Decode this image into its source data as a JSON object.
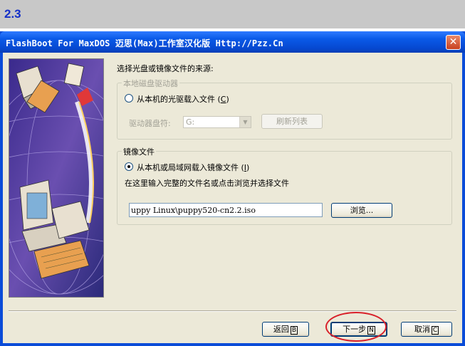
{
  "step_label": "2.3",
  "window": {
    "title": "FlashBoot For MaxDOS 迈思(Max)工作室汉化版 Http://Pzz.Cn",
    "close_glyph": "✕"
  },
  "prompt": "选择光盘或镜像文件的来源:",
  "local_drive": {
    "group_label": "本地磁盘驱动器",
    "radio_label": "从本机的光驱载入文件",
    "radio_key": "C",
    "radio_checked": false,
    "drive_label": "驱动器盘符:",
    "drive_value": "G:",
    "refresh_label": "刷新列表"
  },
  "image_file": {
    "group_label": "镜像文件",
    "radio_label": "从本机或局域网载入镜像文件",
    "radio_key": "I",
    "radio_checked": true,
    "hint": "在这里输入完整的文件名或点击浏览并选择文件",
    "path_value": "uppy Linux\\puppy520-cn2.2.iso",
    "browse_label": "浏览..."
  },
  "footer": {
    "back_label": "返回",
    "back_key": "B",
    "next_label": "下一步",
    "next_key": "N",
    "cancel_label": "取消",
    "cancel_key": "C"
  },
  "colors": {
    "titlebar": "#0a5ae8",
    "dialog_bg": "#ece9d8",
    "highlight_ring": "#d8202a",
    "step_label": "#1530c8"
  }
}
